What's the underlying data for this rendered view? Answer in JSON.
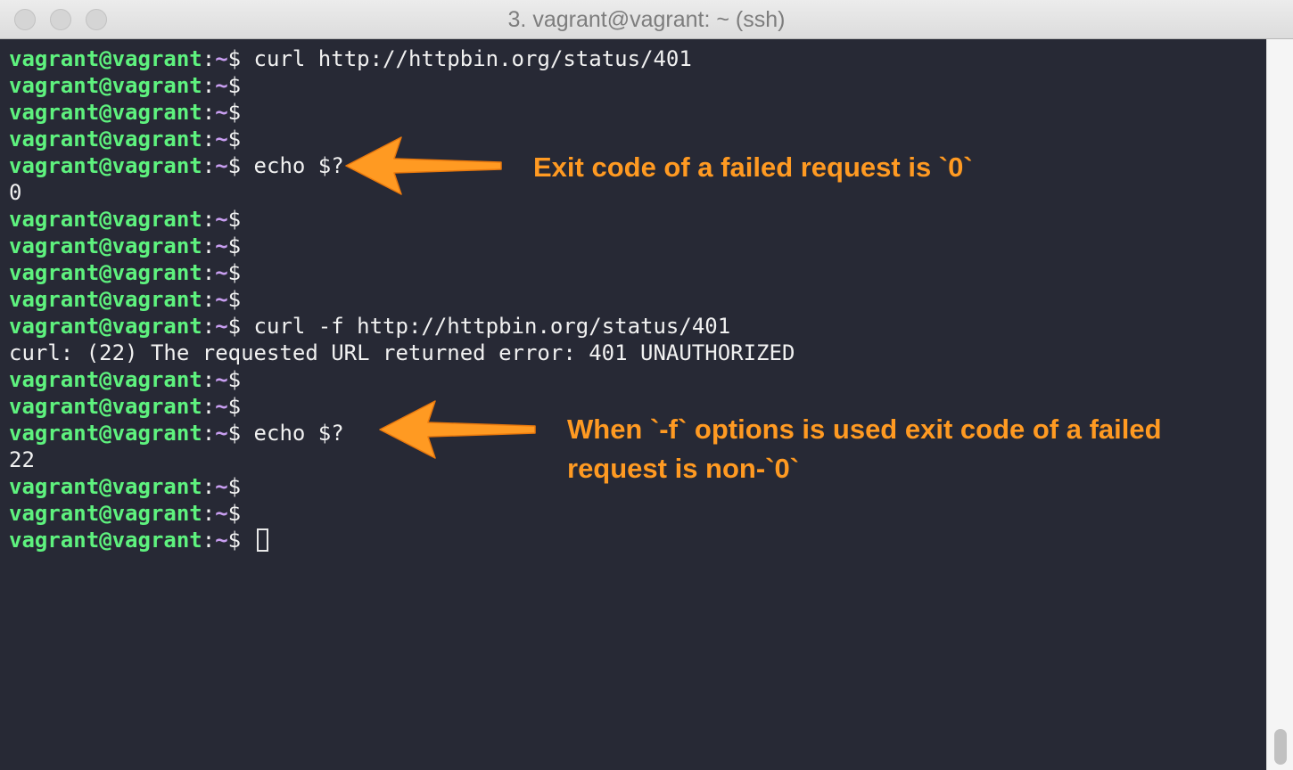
{
  "window": {
    "title": "3. vagrant@vagrant: ~ (ssh)"
  },
  "prompt": {
    "user": "vagrant@vagrant",
    "colon": ":",
    "path": "~",
    "dollar": "$"
  },
  "terminal": {
    "lines": [
      {
        "type": "prompt",
        "cmd": " curl http://httpbin.org/status/401"
      },
      {
        "type": "prompt",
        "cmd": ""
      },
      {
        "type": "prompt",
        "cmd": ""
      },
      {
        "type": "prompt",
        "cmd": ""
      },
      {
        "type": "prompt",
        "cmd": " echo $?"
      },
      {
        "type": "output",
        "text": "0"
      },
      {
        "type": "prompt",
        "cmd": ""
      },
      {
        "type": "prompt",
        "cmd": ""
      },
      {
        "type": "prompt",
        "cmd": ""
      },
      {
        "type": "prompt",
        "cmd": ""
      },
      {
        "type": "prompt",
        "cmd": " curl -f http://httpbin.org/status/401"
      },
      {
        "type": "output",
        "text": "curl: (22) The requested URL returned error: 401 UNAUTHORIZED"
      },
      {
        "type": "prompt",
        "cmd": ""
      },
      {
        "type": "prompt",
        "cmd": ""
      },
      {
        "type": "prompt",
        "cmd": " echo $?"
      },
      {
        "type": "output",
        "text": "22"
      },
      {
        "type": "prompt",
        "cmd": ""
      },
      {
        "type": "prompt",
        "cmd": ""
      },
      {
        "type": "prompt",
        "cmd": " ",
        "cursor": true
      }
    ]
  },
  "annotations": [
    {
      "text": "Exit code of a failed request is `0`"
    },
    {
      "text": "When `-f` options is used exit code of a failed\nrequest is non-`0`"
    }
  ],
  "colors": {
    "terminal_bg": "#272935",
    "prompt_user": "#5ef27e",
    "prompt_path": "#c89ef0",
    "annotation": "#ff9a22"
  },
  "icons": {
    "window_controls": [
      "close-button",
      "minimize-button",
      "zoom-button"
    ],
    "annotation_arrow": "arrow-left-icon"
  }
}
